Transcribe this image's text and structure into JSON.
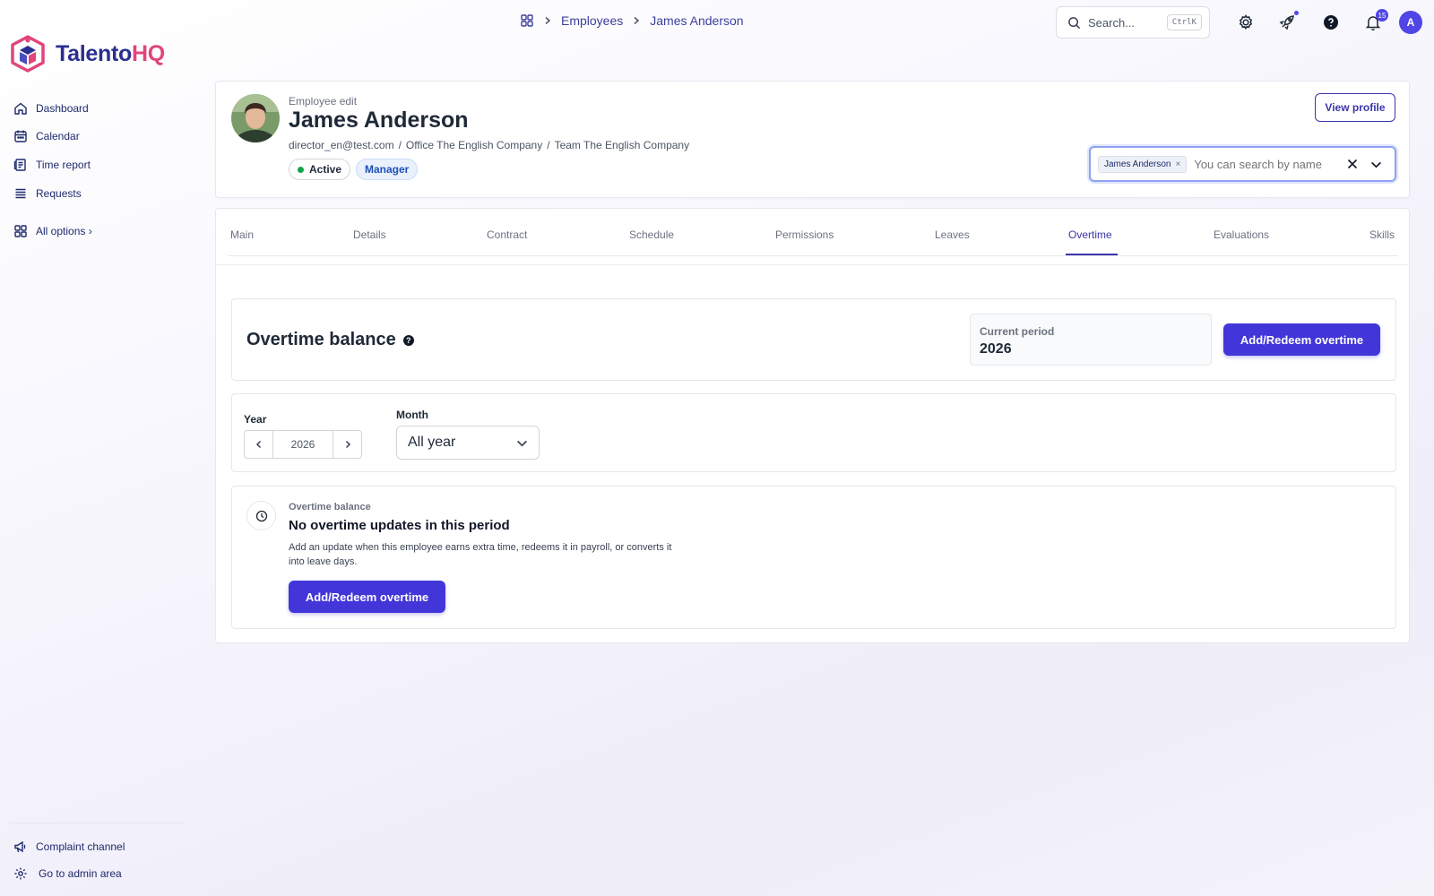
{
  "brand": {
    "name_main": "Talento",
    "name_accent": "HQ"
  },
  "sidebar": {
    "items": [
      {
        "label": "Dashboard",
        "icon": "home-icon"
      },
      {
        "label": "Calendar",
        "icon": "calendar-icon"
      },
      {
        "label": "Time report",
        "icon": "time-report-icon"
      },
      {
        "label": "Requests",
        "icon": "requests-icon"
      }
    ],
    "all_options": "All options ›",
    "footer": [
      {
        "label": "Complaint channel",
        "icon": "megaphone-icon"
      },
      {
        "label": "Go to admin area",
        "icon": "gear-icon"
      }
    ]
  },
  "topbar": {
    "breadcrumb": [
      "Employees",
      "James Anderson"
    ],
    "search_placeholder": "Search...",
    "search_shortcut": "CtrlK",
    "notifications_count": "15",
    "user_initial": "A"
  },
  "employee": {
    "kicker": "Employee edit",
    "name": "James Anderson",
    "email": "director_en@test.com",
    "office": "Office The English Company",
    "team": "Team The English Company",
    "sep": "/",
    "status": "Active",
    "role": "Manager",
    "view_profile": "View profile",
    "selector": {
      "chip": "James Anderson",
      "chip_remove": "×",
      "placeholder": "You can search by name"
    }
  },
  "tabs": [
    {
      "label": "Main"
    },
    {
      "label": "Details"
    },
    {
      "label": "Contract"
    },
    {
      "label": "Schedule"
    },
    {
      "label": "Permissions"
    },
    {
      "label": "Leaves"
    },
    {
      "label": "Overtime",
      "active": true
    },
    {
      "label": "Evaluations"
    },
    {
      "label": "Skills"
    }
  ],
  "overtime": {
    "title": "Overtime balance",
    "help": "?",
    "period_label": "Current period",
    "period_value": "2026",
    "add_button": "Add/Redeem overtime",
    "filters": {
      "year_label": "Year",
      "year_value": "2026",
      "month_label": "Month",
      "month_value": "All year"
    },
    "empty": {
      "kicker": "Overtime balance",
      "title": "No overtime updates in this period",
      "description": "Add an update when this employee earns extra time, redeems it in payroll, or converts it into leave days.",
      "button": "Add/Redeem overtime"
    }
  },
  "colors": {
    "primary": "#4336d9",
    "brand_navy": "#2b2f8f",
    "brand_pink": "#e0457b",
    "status_active": "#16a34a"
  }
}
